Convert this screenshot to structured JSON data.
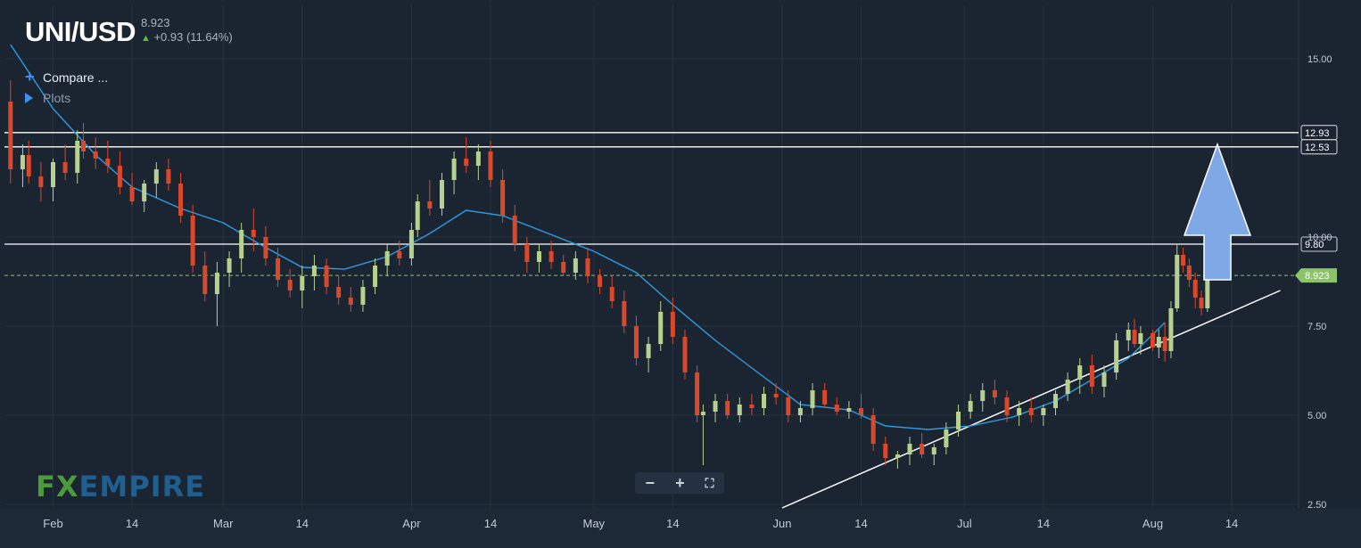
{
  "header": {
    "pair": "UNI/USD",
    "price": "8.923",
    "change": "+0.93 (11.64%)",
    "change_icon": "arrow-up-icon"
  },
  "menu": {
    "compare_label": "Compare ...",
    "plots_label": "Plots"
  },
  "logo": {
    "fx": "FX",
    "empire": "EMPIRE"
  },
  "colors": {
    "background": "#1b2532",
    "up_candle": "#b6d08f",
    "down_candle": "#d9482b",
    "ma_line": "#2f9be0",
    "level_line": "#ffffff",
    "price_tag": "#8cc46a",
    "arrow_fill": "#7fa8e6"
  },
  "chart_data": {
    "type": "candlestick",
    "title": "UNI/USD",
    "x_tick_labels": [
      "Feb",
      "14",
      "Mar",
      "14",
      "Apr",
      "14",
      "May",
      "14",
      "Jun",
      "14",
      "Jul",
      "14",
      "Aug",
      "14"
    ],
    "x_tick_dates": [
      "2021-02-01",
      "2021-02-14",
      "2021-03-01",
      "2021-03-14",
      "2021-04-01",
      "2021-04-14",
      "2021-05-01",
      "2021-05-14",
      "2021-06-01",
      "2021-06-14",
      "2021-07-01",
      "2021-07-14",
      "2021-08-01",
      "2021-08-14"
    ],
    "y_tick_labels": [
      "15.00",
      "10.00",
      "7.50",
      "5.00",
      "2.50"
    ],
    "y_ticks": [
      15,
      10,
      7.5,
      5,
      2.5
    ],
    "ylim": [
      2.4,
      16.5
    ],
    "grid": true,
    "horizontal_levels": [
      {
        "label": "12.93",
        "value": 12.93
      },
      {
        "label": "12.53",
        "value": 12.53
      },
      {
        "label": "9.80",
        "value": 9.8
      }
    ],
    "last_price": {
      "label": "8.923",
      "value": 8.923
    },
    "moving_average": [
      [
        "2021-01-25",
        15.4
      ],
      [
        "2021-02-01",
        13.6
      ],
      [
        "2021-02-08",
        12.3
      ],
      [
        "2021-02-14",
        11.4
      ],
      [
        "2021-02-22",
        10.8
      ],
      [
        "2021-03-01",
        10.4
      ],
      [
        "2021-03-07",
        9.8
      ],
      [
        "2021-03-14",
        9.15
      ],
      [
        "2021-03-21",
        9.1
      ],
      [
        "2021-03-28",
        9.45
      ],
      [
        "2021-04-04",
        10.1
      ],
      [
        "2021-04-10",
        10.75
      ],
      [
        "2021-04-16",
        10.6
      ],
      [
        "2021-04-22",
        10.2
      ],
      [
        "2021-05-01",
        9.6
      ],
      [
        "2021-05-08",
        9.0
      ],
      [
        "2021-05-14",
        8.1
      ],
      [
        "2021-05-21",
        7.1
      ],
      [
        "2021-05-28",
        6.2
      ],
      [
        "2021-06-04",
        5.3
      ],
      [
        "2021-06-12",
        5.15
      ],
      [
        "2021-06-18",
        4.7
      ],
      [
        "2021-06-25",
        4.6
      ],
      [
        "2021-07-02",
        4.7
      ],
      [
        "2021-07-09",
        4.95
      ],
      [
        "2021-07-16",
        5.4
      ],
      [
        "2021-07-22",
        6.0
      ],
      [
        "2021-07-28",
        6.6
      ],
      [
        "2021-08-03",
        7.6
      ]
    ],
    "trendline": [
      [
        "2021-06-01",
        2.4
      ],
      [
        "2021-08-22",
        8.5
      ]
    ],
    "candles": [
      [
        "2021-01-25",
        13.8,
        14.4,
        11.5,
        11.9
      ],
      [
        "2021-01-27",
        11.9,
        12.6,
        11.4,
        12.3
      ],
      [
        "2021-01-28",
        12.3,
        12.7,
        11.5,
        11.7
      ],
      [
        "2021-01-30",
        11.7,
        12.1,
        11.0,
        11.4
      ],
      [
        "2021-02-01",
        11.4,
        12.2,
        11.0,
        12.1
      ],
      [
        "2021-02-03",
        12.1,
        12.6,
        11.6,
        11.8
      ],
      [
        "2021-02-05",
        11.8,
        13.0,
        11.5,
        12.7
      ],
      [
        "2021-02-06",
        12.7,
        13.2,
        12.2,
        12.4
      ],
      [
        "2021-02-08",
        12.4,
        12.8,
        11.9,
        12.2
      ],
      [
        "2021-02-10",
        12.2,
        12.7,
        11.8,
        12.0
      ],
      [
        "2021-02-12",
        12.0,
        12.4,
        11.2,
        11.4
      ],
      [
        "2021-02-14",
        11.4,
        11.8,
        10.9,
        11.0
      ],
      [
        "2021-02-16",
        11.0,
        11.6,
        10.7,
        11.5
      ],
      [
        "2021-02-18",
        11.5,
        12.1,
        11.1,
        11.9
      ],
      [
        "2021-02-20",
        11.9,
        12.2,
        11.3,
        11.5
      ],
      [
        "2021-02-22",
        11.5,
        11.8,
        10.4,
        10.6
      ],
      [
        "2021-02-24",
        10.6,
        10.9,
        9.0,
        9.2
      ],
      [
        "2021-02-26",
        9.2,
        9.6,
        8.2,
        8.4
      ],
      [
        "2021-02-28",
        8.4,
        9.3,
        7.5,
        9.0
      ],
      [
        "2021-03-02",
        9.0,
        9.6,
        8.6,
        9.4
      ],
      [
        "2021-03-04",
        9.4,
        10.4,
        9.0,
        10.2
      ],
      [
        "2021-03-06",
        10.2,
        10.8,
        9.6,
        10.0
      ],
      [
        "2021-03-08",
        10.0,
        10.3,
        9.2,
        9.4
      ],
      [
        "2021-03-10",
        9.4,
        9.7,
        8.6,
        8.8
      ],
      [
        "2021-03-12",
        8.8,
        9.1,
        8.3,
        8.5
      ],
      [
        "2021-03-14",
        8.5,
        9.2,
        8.0,
        8.9
      ],
      [
        "2021-03-16",
        8.9,
        9.5,
        8.5,
        9.2
      ],
      [
        "2021-03-18",
        9.2,
        9.4,
        8.4,
        8.6
      ],
      [
        "2021-03-20",
        8.6,
        8.9,
        8.1,
        8.3
      ],
      [
        "2021-03-22",
        8.3,
        8.6,
        7.9,
        8.1
      ],
      [
        "2021-03-24",
        8.1,
        8.8,
        7.9,
        8.6
      ],
      [
        "2021-03-26",
        8.6,
        9.4,
        8.4,
        9.2
      ],
      [
        "2021-03-28",
        9.2,
        9.8,
        8.9,
        9.6
      ],
      [
        "2021-03-30",
        9.6,
        9.9,
        9.2,
        9.4
      ],
      [
        "2021-04-01",
        9.4,
        10.4,
        9.2,
        10.2
      ],
      [
        "2021-04-02",
        10.2,
        11.2,
        10.0,
        11.0
      ],
      [
        "2021-04-04",
        11.0,
        11.6,
        10.6,
        10.8
      ],
      [
        "2021-04-06",
        10.8,
        11.8,
        10.6,
        11.6
      ],
      [
        "2021-04-08",
        11.6,
        12.4,
        11.2,
        12.2
      ],
      [
        "2021-04-10",
        12.2,
        12.8,
        11.8,
        12.0
      ],
      [
        "2021-04-12",
        12.0,
        12.6,
        11.6,
        12.4
      ],
      [
        "2021-04-14",
        12.4,
        12.7,
        11.4,
        11.6
      ],
      [
        "2021-04-16",
        11.6,
        11.9,
        10.4,
        10.6
      ],
      [
        "2021-04-18",
        10.6,
        10.9,
        9.6,
        9.8
      ],
      [
        "2021-04-20",
        9.8,
        10.0,
        9.0,
        9.3
      ],
      [
        "2021-04-22",
        9.3,
        9.8,
        9.0,
        9.6
      ],
      [
        "2021-04-24",
        9.6,
        9.9,
        9.1,
        9.3
      ],
      [
        "2021-04-26",
        9.3,
        9.5,
        8.9,
        9.0
      ],
      [
        "2021-04-28",
        9.0,
        9.6,
        8.8,
        9.4
      ],
      [
        "2021-04-30",
        9.4,
        9.7,
        8.7,
        8.9
      ],
      [
        "2021-05-02",
        8.9,
        9.1,
        8.4,
        8.6
      ],
      [
        "2021-05-04",
        8.6,
        8.9,
        8.0,
        8.2
      ],
      [
        "2021-05-06",
        8.2,
        8.5,
        7.3,
        7.5
      ],
      [
        "2021-05-08",
        7.5,
        7.8,
        6.4,
        6.6
      ],
      [
        "2021-05-10",
        6.6,
        7.2,
        6.2,
        7.0
      ],
      [
        "2021-05-12",
        7.0,
        8.2,
        6.8,
        7.9
      ],
      [
        "2021-05-14",
        7.9,
        8.3,
        7.0,
        7.2
      ],
      [
        "2021-05-16",
        7.2,
        7.4,
        6.0,
        6.2
      ],
      [
        "2021-05-18",
        6.2,
        6.4,
        4.8,
        5.0
      ],
      [
        "2021-05-19",
        5.0,
        5.3,
        3.6,
        5.1
      ],
      [
        "2021-05-21",
        5.1,
        5.6,
        4.8,
        5.4
      ],
      [
        "2021-05-23",
        5.4,
        5.6,
        4.9,
        5.0
      ],
      [
        "2021-05-25",
        5.0,
        5.5,
        4.8,
        5.3
      ],
      [
        "2021-05-27",
        5.3,
        5.6,
        5.0,
        5.2
      ],
      [
        "2021-05-29",
        5.2,
        5.8,
        5.0,
        5.6
      ],
      [
        "2021-05-31",
        5.6,
        5.9,
        5.3,
        5.5
      ],
      [
        "2021-06-02",
        5.5,
        5.7,
        4.8,
        5.0
      ],
      [
        "2021-06-04",
        5.0,
        5.4,
        4.8,
        5.2
      ],
      [
        "2021-06-06",
        5.2,
        5.9,
        5.0,
        5.7
      ],
      [
        "2021-06-08",
        5.7,
        5.9,
        5.2,
        5.3
      ],
      [
        "2021-06-10",
        5.3,
        5.5,
        5.0,
        5.1
      ],
      [
        "2021-06-12",
        5.1,
        5.4,
        4.9,
        5.2
      ],
      [
        "2021-06-14",
        5.2,
        5.6,
        4.9,
        5.0
      ],
      [
        "2021-06-16",
        5.0,
        5.2,
        4.0,
        4.2
      ],
      [
        "2021-06-18",
        4.2,
        4.4,
        3.6,
        3.8
      ],
      [
        "2021-06-20",
        3.8,
        4.0,
        3.5,
        3.9
      ],
      [
        "2021-06-22",
        3.9,
        4.4,
        3.6,
        4.2
      ],
      [
        "2021-06-24",
        4.2,
        4.5,
        3.8,
        3.9
      ],
      [
        "2021-06-26",
        3.9,
        4.2,
        3.6,
        4.1
      ],
      [
        "2021-06-28",
        4.1,
        4.8,
        3.9,
        4.6
      ],
      [
        "2021-06-30",
        4.6,
        5.3,
        4.4,
        5.1
      ],
      [
        "2021-07-02",
        5.1,
        5.6,
        4.9,
        5.4
      ],
      [
        "2021-07-04",
        5.4,
        5.9,
        5.1,
        5.7
      ],
      [
        "2021-07-06",
        5.7,
        6.0,
        5.3,
        5.5
      ],
      [
        "2021-07-08",
        5.5,
        5.7,
        4.8,
        5.0
      ],
      [
        "2021-07-10",
        5.0,
        5.4,
        4.7,
        5.2
      ],
      [
        "2021-07-12",
        5.2,
        5.5,
        4.8,
        5.0
      ],
      [
        "2021-07-14",
        5.0,
        5.3,
        4.7,
        5.2
      ],
      [
        "2021-07-16",
        5.2,
        5.7,
        5.0,
        5.6
      ],
      [
        "2021-07-18",
        5.6,
        6.2,
        5.4,
        6.0
      ],
      [
        "2021-07-20",
        6.0,
        6.6,
        5.6,
        6.4
      ],
      [
        "2021-07-22",
        6.4,
        6.7,
        5.6,
        5.8
      ],
      [
        "2021-07-24",
        5.8,
        6.4,
        5.5,
        6.2
      ],
      [
        "2021-07-26",
        6.2,
        7.3,
        6.0,
        7.1
      ],
      [
        "2021-07-28",
        7.1,
        7.6,
        6.8,
        7.4
      ],
      [
        "2021-07-29",
        7.4,
        7.7,
        6.9,
        7.0
      ],
      [
        "2021-07-30",
        7.0,
        7.5,
        6.7,
        7.3
      ],
      [
        "2021-08-01",
        7.3,
        7.4,
        6.8,
        6.9
      ],
      [
        "2021-08-02",
        6.9,
        7.4,
        6.6,
        7.2
      ],
      [
        "2021-08-03",
        7.2,
        7.6,
        6.5,
        6.8
      ],
      [
        "2021-08-04",
        6.8,
        8.2,
        6.6,
        8.0
      ],
      [
        "2021-08-05",
        8.0,
        9.8,
        7.9,
        9.5
      ],
      [
        "2021-08-06",
        9.5,
        9.7,
        9.0,
        9.2
      ],
      [
        "2021-08-07",
        9.2,
        9.4,
        8.6,
        8.8
      ],
      [
        "2021-08-08",
        8.8,
        9.0,
        8.0,
        8.3
      ],
      [
        "2021-08-09",
        8.3,
        8.5,
        7.8,
        8.0
      ],
      [
        "2021-08-10",
        8.0,
        9.0,
        7.9,
        8.923
      ]
    ],
    "annotation": {
      "type": "arrow-up",
      "from": 8.8,
      "to": 12.6
    }
  }
}
